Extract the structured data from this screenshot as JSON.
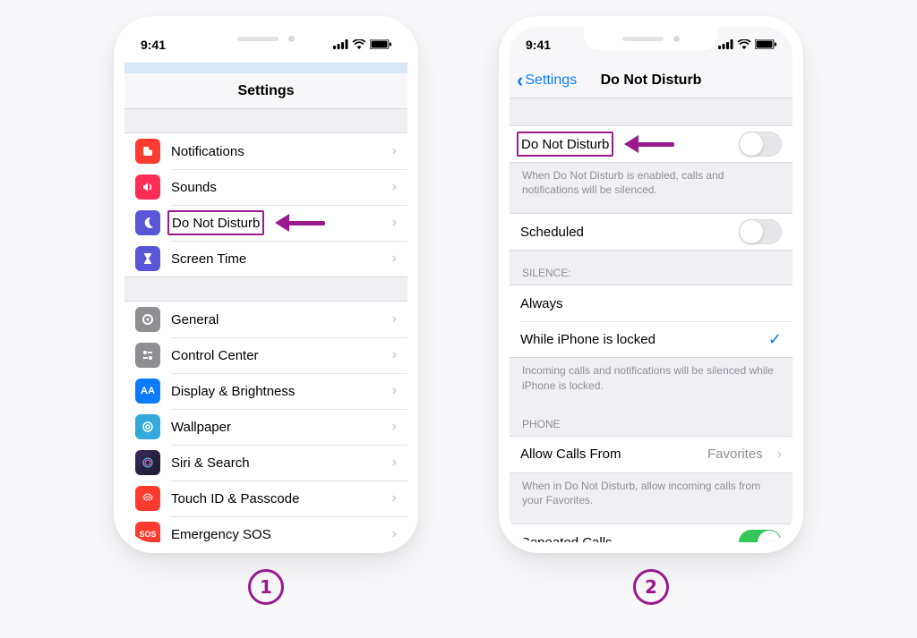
{
  "status": {
    "time": "9:41"
  },
  "screen1": {
    "title": "Settings",
    "items": [
      {
        "label": "Notifications"
      },
      {
        "label": "Sounds"
      },
      {
        "label": "Do Not Disturb"
      },
      {
        "label": "Screen Time"
      }
    ],
    "items2": [
      {
        "label": "General"
      },
      {
        "label": "Control Center"
      },
      {
        "label": "Display & Brightness"
      },
      {
        "label": "Wallpaper"
      },
      {
        "label": "Siri & Search"
      },
      {
        "label": "Touch ID & Passcode"
      },
      {
        "label": "Emergency SOS"
      }
    ]
  },
  "screen2": {
    "back": "Settings",
    "title": "Do Not Disturb",
    "row_dnd": "Do Not Disturb",
    "desc1": "When Do Not Disturb is enabled, calls and notifications will be silenced.",
    "row_scheduled": "Scheduled",
    "header_silence": "SILENCE:",
    "row_always": "Always",
    "row_locked": "While iPhone is locked",
    "desc2": "Incoming calls and notifications will be silenced while iPhone is locked.",
    "header_phone": "PHONE",
    "row_allow": "Allow Calls From",
    "value_allow": "Favorites",
    "desc3": "When in Do Not Disturb, allow incoming calls from your Favorites.",
    "row_repeated": "Repeated Calls"
  },
  "steps": {
    "one": "1",
    "two": "2"
  }
}
